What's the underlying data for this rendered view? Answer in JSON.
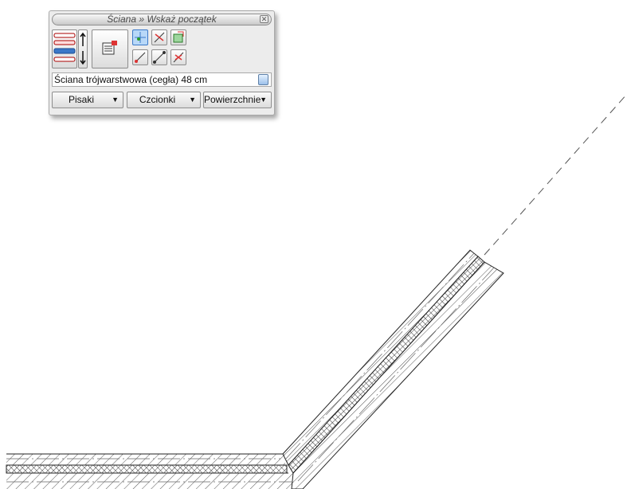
{
  "toolbox": {
    "title": "Ściana » Wskaż początek",
    "close_icon": "close-icon",
    "wall_type": "Ściana trójwarstwowa (cegła) 48 cm",
    "dropdowns": [
      {
        "label": "Pisaki"
      },
      {
        "label": "Czcionki"
      },
      {
        "label": "Powierzchnie"
      }
    ],
    "tools": [
      "wall-layer-selector-icon",
      "flip-wall-icon",
      "wall-properties-icon",
      "start-point-icon",
      "delete-segment-icon",
      "continue-wall-icon",
      "rotate-point-icon",
      "line-segment-icon",
      "cut-segment-icon"
    ]
  },
  "drawing": {
    "wall_color": "#444444",
    "accent_blue": "#3a78c8"
  }
}
